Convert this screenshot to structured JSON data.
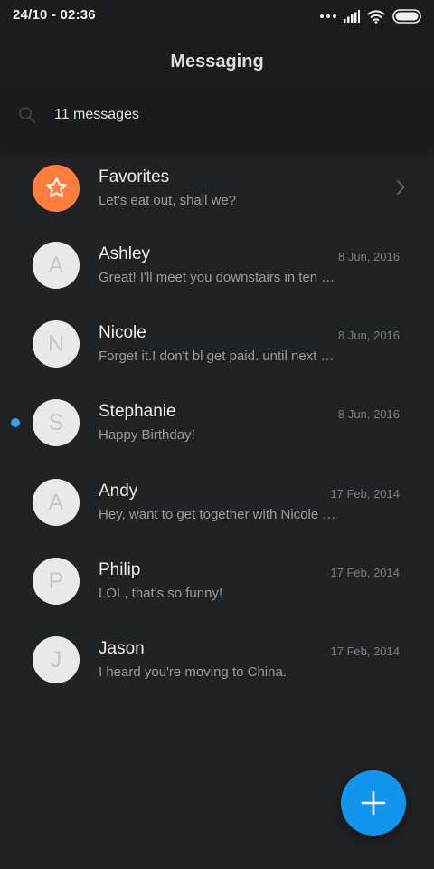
{
  "status_bar": {
    "time": "24/10 - 02:36"
  },
  "header": {
    "title": "Messaging"
  },
  "search": {
    "text": "11 messages"
  },
  "conversations": [
    {
      "name": "Favorites",
      "preview": "Let's eat out, shall we?",
      "date": "",
      "initial": "",
      "unread": false,
      "favorite": true
    },
    {
      "name": "Ashley",
      "preview": "Great! I'll meet you downstairs in ten …",
      "date": "8 Jun, 2016",
      "initial": "A",
      "unread": false
    },
    {
      "name": "Nicole",
      "preview": "Forget it.I don't bl get paid. until next …",
      "date": "8 Jun, 2016",
      "initial": "N",
      "unread": false
    },
    {
      "name": "Stephanie",
      "preview": "Happy Birthday!",
      "date": "8 Jun, 2016",
      "initial": "S",
      "unread": true
    },
    {
      "name": "Andy",
      "preview": "Hey, want to get together with Nicole …",
      "date": "17 Feb, 2014",
      "initial": "A",
      "unread": false
    },
    {
      "name": "Philip",
      "preview": "LOL, that's so funny!",
      "date": "17 Feb, 2014",
      "initial": "P",
      "unread": false
    },
    {
      "name": "Jason",
      "preview": "I heard you're moving to China.",
      "date": "17 Feb, 2014",
      "initial": "J",
      "unread": false
    }
  ],
  "colors": {
    "background": "#212223",
    "favorite_accent": "#ff7d3f",
    "unread_dot": "#2fa4f2",
    "fab": "#1295ec"
  },
  "icons": {
    "favorite": "star-icon",
    "compose": "plus-icon",
    "search": "search-icon",
    "more": "chevron-right-icon"
  }
}
